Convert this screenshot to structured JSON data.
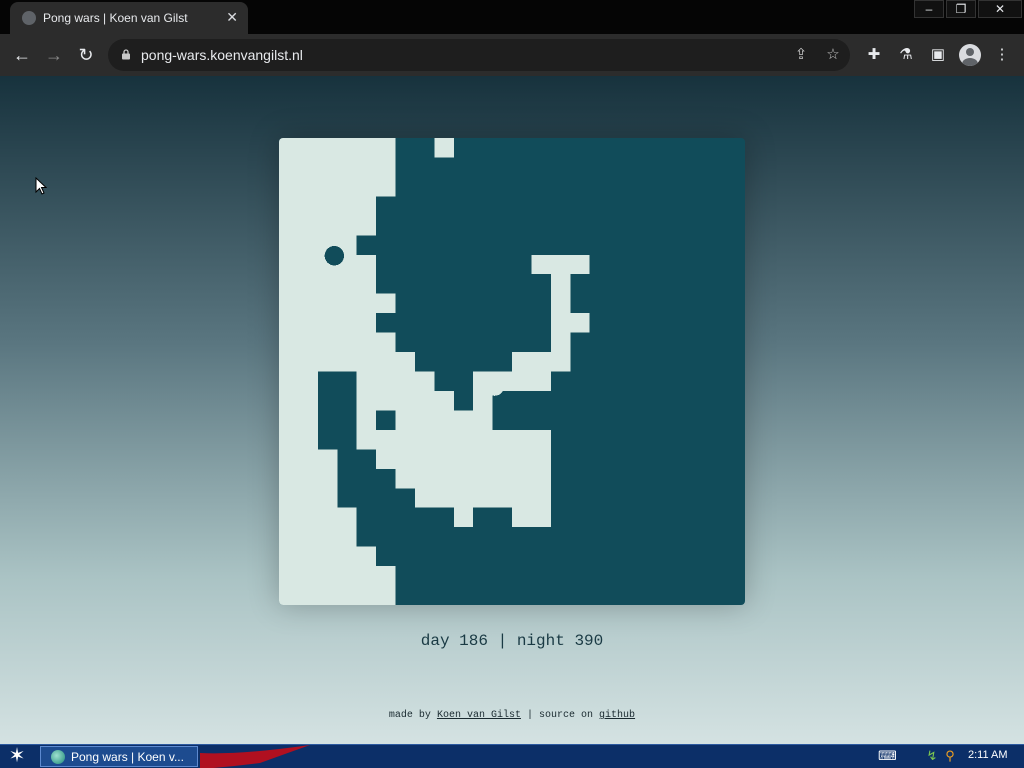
{
  "browser": {
    "tab_title": "Pong wars | Koen van Gilst",
    "url": "pong-wars.koenvangilst.nl"
  },
  "icons": {
    "back": "arrow-left-icon",
    "forward": "arrow-right-icon",
    "reload": "reload-icon",
    "lock": "lock-icon",
    "share": "share-icon",
    "bookmark": "star-icon",
    "extensions": "puzzle-icon",
    "labs": "flask-icon",
    "side_panel": "side-panel-icon",
    "profile": "profile-avatar-icon",
    "menu": "kebab-menu-icon"
  },
  "game": {
    "day_color": "#D9E8E3",
    "night_color": "#114C5A",
    "score": {
      "day_label": "day",
      "day": "186",
      "separator": "|",
      "night_label": "night",
      "night": "390"
    }
  },
  "footer": {
    "made_by": "made by",
    "author": "Koen van Gilst",
    "separator": "|",
    "source_on": "source on",
    "source_link": "github"
  },
  "taskbar": {
    "item_label": "Pong wars | Koen v...",
    "clock": "2:11 AM"
  }
}
